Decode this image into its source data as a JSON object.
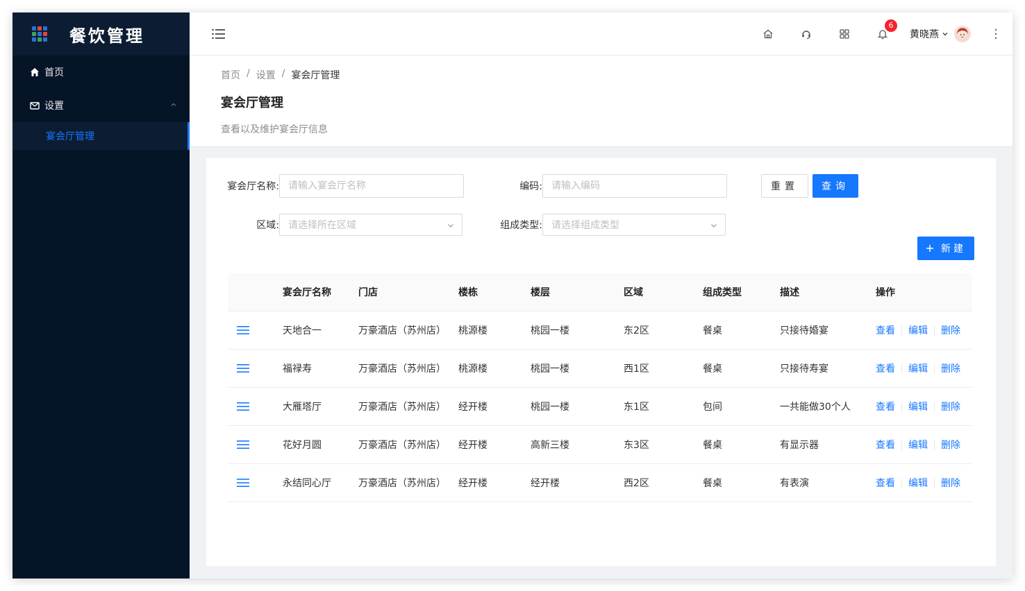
{
  "app": {
    "title": "餐饮管理"
  },
  "sidebar": {
    "items": [
      {
        "label": "首页",
        "icon": "home-icon"
      },
      {
        "label": "设置",
        "icon": "mail-icon",
        "expanded": true
      }
    ],
    "sub_items": [
      {
        "label": "宴会厅管理",
        "active": true
      }
    ]
  },
  "topbar": {
    "notification_count": "6",
    "user_name": "黄晓燕"
  },
  "breadcrumb": {
    "items": [
      "首页",
      "设置",
      "宴会厅管理"
    ]
  },
  "page": {
    "title": "宴会厅管理",
    "description": "查看以及维护宴会厅信息"
  },
  "filters": {
    "name_label": "宴会厅名称:",
    "name_placeholder": "请输入宴会厅名称",
    "code_label": "编码:",
    "code_placeholder": "请输入编码",
    "area_label": "区域:",
    "area_placeholder": "请选择所在区域",
    "type_label": "组成类型:",
    "type_placeholder": "请选择组成类型",
    "reset_label": "重置",
    "query_label": "查询"
  },
  "actions": {
    "new_label": "新建"
  },
  "table": {
    "columns": [
      "宴会厅名称",
      "门店",
      "楼栋",
      "楼层",
      "区域",
      "组成类型",
      "描述",
      "操作"
    ],
    "rows": [
      {
        "name": "天地合一",
        "store": "万豪酒店（苏州店）",
        "building": "桃源楼",
        "floor": "桃园一楼",
        "area": "东2区",
        "type": "餐桌",
        "desc": "只接待婚宴"
      },
      {
        "name": "福禄寿",
        "store": "万豪酒店（苏州店）",
        "building": "桃源楼",
        "floor": "桃园一楼",
        "area": "西1区",
        "type": "餐桌",
        "desc": "只接待寿宴"
      },
      {
        "name": "大雁塔厅",
        "store": "万豪酒店（苏州店）",
        "building": "经开楼",
        "floor": "桃园一楼",
        "area": "东1区",
        "type": "包间",
        "desc": "一共能做30个人"
      },
      {
        "name": "花好月圆",
        "store": "万豪酒店（苏州店）",
        "building": "经开楼",
        "floor": "高新三楼",
        "area": "东3区",
        "type": "餐桌",
        "desc": "有显示器"
      },
      {
        "name": "永结同心厅",
        "store": "万豪酒店（苏州店）",
        "building": "经开楼",
        "floor": "经开楼",
        "area": "西2区",
        "type": "餐桌",
        "desc": "有表演"
      }
    ],
    "row_actions": {
      "view": "查看",
      "edit": "编辑",
      "delete": "删除"
    }
  },
  "colors": {
    "primary": "#1677ff",
    "sidebar_bg": "#061427",
    "badge": "#f5222d"
  }
}
